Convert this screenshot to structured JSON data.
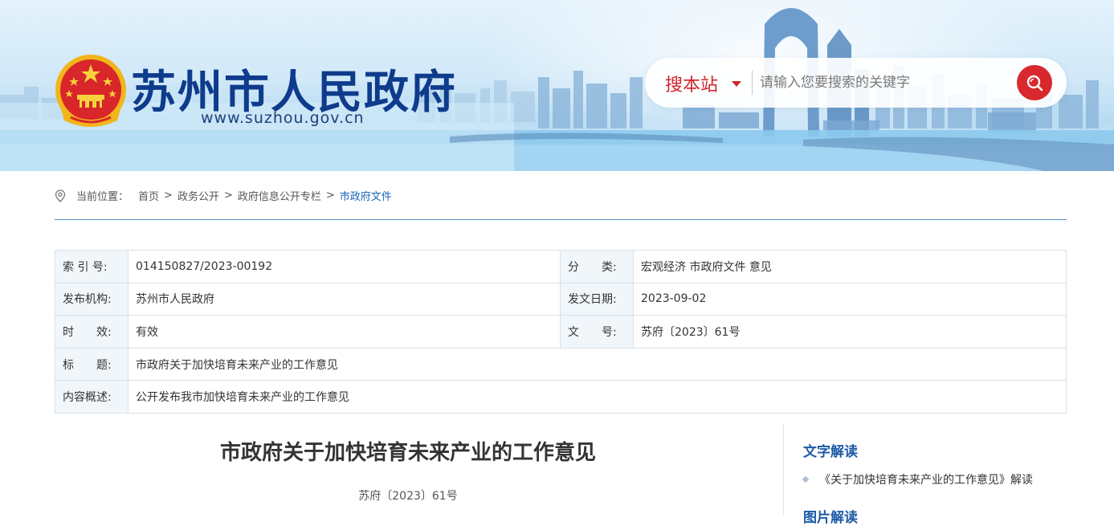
{
  "header": {
    "site_title": "苏州市人民政府",
    "site_url": "www.suzhou.gov.cn",
    "search": {
      "scope_label": "搜本站",
      "placeholder": "请输入您要搜索的关键字"
    }
  },
  "breadcrumb": {
    "prefix": "当前位置：",
    "items": [
      "首页",
      "政务公开",
      "政府信息公开专栏",
      "市政府文件"
    ],
    "separator": ">"
  },
  "meta": {
    "index_label": "索 引 号:",
    "index_value": "014150827/2023-00192",
    "category_label": "分　　类:",
    "category_value": "宏观经济 市政府文件 意见",
    "publisher_label": "发布机构:",
    "publisher_value": "苏州市人民政府",
    "date_label": "发文日期:",
    "date_value": "2023-09-02",
    "validity_label": "时　　效:",
    "validity_value": "有效",
    "docno_label": "文　　号:",
    "docno_value": "苏府〔2023〕61号",
    "title_label": "标　　题:",
    "title_value": "市政府关于加快培育未来产业的工作意见",
    "summary_label": "内容概述:",
    "summary_value": "公开发布我市加快培育未来产业的工作意见"
  },
  "article": {
    "title": "市政府关于加快培育未来产业的工作意见",
    "doc_number": "苏府〔2023〕61号"
  },
  "sidebar": {
    "text_interpretation_heading": "文字解读",
    "text_interpretation_items": [
      "《关于加快培育未来产业的工作意见》解读"
    ],
    "image_interpretation_heading": "图片解读"
  },
  "colors": {
    "brand_blue": "#0f3b8c",
    "search_red": "#d8282e",
    "link_blue": "#1b63b5",
    "table_label_bg": "#f1f6fb"
  }
}
